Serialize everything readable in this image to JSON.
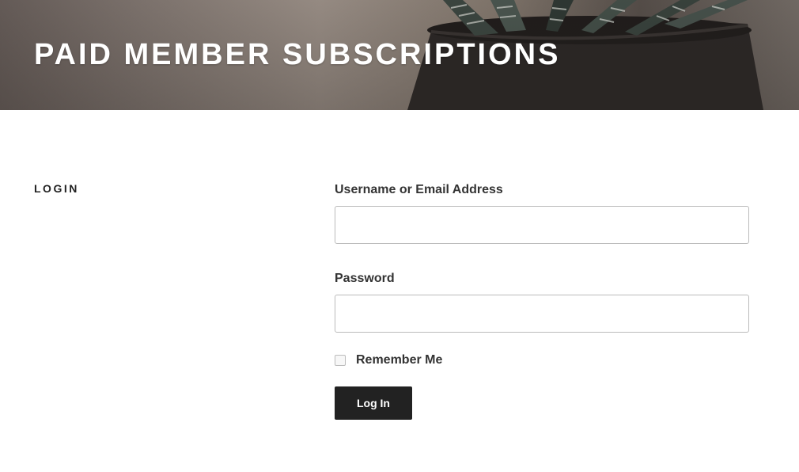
{
  "site": {
    "title": "PAID MEMBER SUBSCRIPTIONS"
  },
  "section": {
    "title": "LOGIN"
  },
  "form": {
    "username_label": "Username or Email Address",
    "username_value": "",
    "password_label": "Password",
    "password_value": "",
    "remember_label": "Remember Me",
    "remember_checked": false,
    "submit_label": "Log In"
  },
  "colors": {
    "button_bg": "#222222",
    "button_text": "#ffffff",
    "title_text": "#ffffff",
    "input_border": "#bbbbbb"
  },
  "icons": {
    "header_image": "succulent-plant-in-pot-image"
  }
}
